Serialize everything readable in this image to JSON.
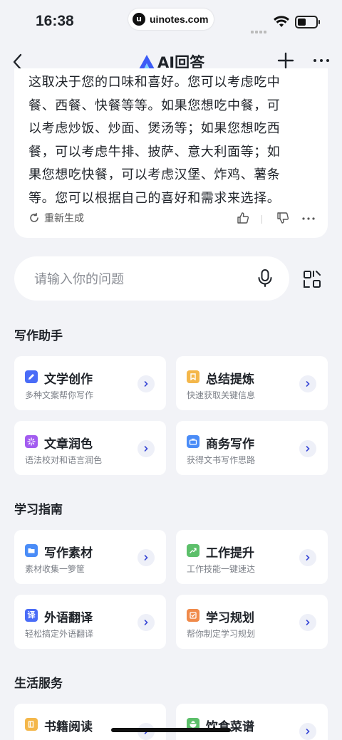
{
  "status": {
    "time": "16:38",
    "watermark_site": "uinotes.com",
    "watermark_badge": "u"
  },
  "nav": {
    "title": "AI回答"
  },
  "answer": {
    "lines": [
      "这取决于您的口味和喜好。您可以考虑吃中",
      "餐、西餐、快餐等等。如果您想吃中餐，可",
      "以考虑炒饭、炒面、煲汤等；如果您想吃西",
      "餐，可以考虑牛排、披萨、意大利面等；如",
      "果您想吃快餐，可以考虑汉堡、炸鸡、薯条",
      "等。您可以根据自己的喜好和需求来选择。"
    ],
    "regenerate_label": "重新生成"
  },
  "input": {
    "placeholder": "请输入你的问题"
  },
  "sections": [
    {
      "title": "写作助手",
      "cards": [
        {
          "title": "文学创作",
          "subtitle": "多种文案帮你写作",
          "icon": "pencil-icon",
          "color": "#4a6cf7"
        },
        {
          "title": "总结提炼",
          "subtitle": "快速获取关键信息",
          "icon": "bookmark-icon",
          "color": "#f4b74a"
        },
        {
          "title": "文章润色",
          "subtitle": "语法校对和语言润色",
          "icon": "sparkle-icon",
          "color": "#a35cf0"
        },
        {
          "title": "商务写作",
          "subtitle": "获得文书写作思路",
          "icon": "briefcase-icon",
          "color": "#4a8cf7"
        }
      ]
    },
    {
      "title": "学习指南",
      "cards": [
        {
          "title": "写作素材",
          "subtitle": "素材收集一箩筐",
          "icon": "folder-icon",
          "color": "#4a8cf7"
        },
        {
          "title": "工作提升",
          "subtitle": "工作技能一键速达",
          "icon": "growth-icon",
          "color": "#5cbf6a"
        },
        {
          "title": "外语翻译",
          "subtitle": "轻松搞定外语翻译",
          "icon": "translate-icon",
          "color": "#4a6cf7"
        },
        {
          "title": "学习规划",
          "subtitle": "帮你制定学习规划",
          "icon": "checklist-icon",
          "color": "#f08a4a"
        }
      ]
    },
    {
      "title": "生活服务",
      "cards": [
        {
          "title": "书籍阅读",
          "subtitle": "",
          "icon": "book-icon",
          "color": "#f4b74a"
        },
        {
          "title": "饮食菜谱",
          "subtitle": "",
          "icon": "recipe-icon",
          "color": "#5cbf6a"
        }
      ]
    }
  ]
}
